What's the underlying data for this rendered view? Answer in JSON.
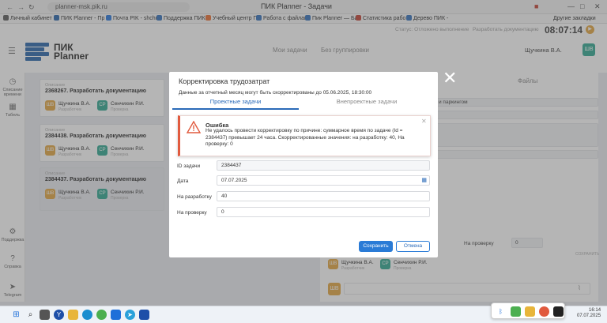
{
  "browser": {
    "url": "planner-msk.pik.ru",
    "window_title": "ПИК Planner - Задачи",
    "other_bookmarks": "Другие закладки",
    "bookmarks": [
      {
        "label": "Личный кабинет",
        "color": "#555555"
      },
      {
        "label": "ПИК Planner - Пр",
        "color": "#1f5fa8"
      },
      {
        "label": "Почта PIK - shchu",
        "color": "#1e6fd9"
      },
      {
        "label": "Поддержка ПИК",
        "color": "#2a6ab8"
      },
      {
        "label": "Учебный центр П",
        "color": "#e8692a"
      },
      {
        "label": "Работа с файлам",
        "color": "#2a6ab8"
      },
      {
        "label": "Пик Planner — Ба",
        "color": "#2a6ab8"
      },
      {
        "label": "Статистика рабо",
        "color": "#c0392b"
      },
      {
        "label": "Дерево ПИК -",
        "color": "#2a6ab8"
      }
    ]
  },
  "header": {
    "status_hint": "Статус: Отложено выполнение",
    "doc_hint": "Разработать документацию",
    "timer": "08:07:14",
    "logo_line1": "ПИК",
    "logo_line2": "Planner",
    "tab_my_tasks": "Мои задачи",
    "tab_no_group": "Без группировки",
    "user_name": "Щучкина В.А.",
    "user_initials": "ШВ"
  },
  "sidebar": {
    "items": [
      {
        "label": "Списание времени",
        "icon": "clock-icon"
      },
      {
        "label": "Табель",
        "icon": "table-icon"
      },
      {
        "label": "Поддержка",
        "icon": "support-icon"
      },
      {
        "label": "Справка",
        "icon": "help-icon"
      },
      {
        "label": "Telegram",
        "icon": "telegram-icon"
      }
    ]
  },
  "tasks": [
    {
      "label": "Описание",
      "title": "2368267. Разработать документацию",
      "p1_name": "Щучкина В.А.",
      "p1_role": "Разработчик",
      "p1_init": "ШВ",
      "p2_name": "Сенчихин Р.И.",
      "p2_role": "Проверка",
      "p2_init": "СР"
    },
    {
      "label": "Описание",
      "title": "2384438. Разработать документацию",
      "p1_name": "Щучкина В.А.",
      "p1_role": "Разработчик",
      "p1_init": "ШВ",
      "p2_name": "Сенчихин Р.И.",
      "p2_role": "Проверка",
      "p2_init": "СР"
    },
    {
      "label": "Описание",
      "title": "2384437. Разработать документацию",
      "p1_name": "Щучкина В.А.",
      "p1_role": "Разработчик",
      "p1_init": "ШВ",
      "p2_name": "Сенчихин Р.И.",
      "p2_role": "Проверка",
      "p2_init": "СР"
    }
  ],
  "right_panel": {
    "tab_files": "Файлы",
    "field1": "и паркингом",
    "check_label": "На проверку",
    "check_value": "0",
    "save_link": "СОХРАНИТЬ",
    "p1_name": "Щучкина В.А.",
    "p1_role": "Разработчик",
    "p1_init": "ШВ",
    "p2_name": "Сенчихин Р.И.",
    "p2_role": "Проверка",
    "p2_init": "СР",
    "comment_init": "ШВ"
  },
  "modal": {
    "title": "Корректировка трудозатрат",
    "subtitle": "Данные за отчетный месяц могут быть скорректированы до 05.06.2025, 18:30:00",
    "tab_project": "Проектные задачи",
    "tab_nonproject": "Внепроектные задачи",
    "fields": [
      {
        "label": "ID задачи",
        "value": "2384437"
      },
      {
        "label": "Дата",
        "value": "07.07.2025"
      },
      {
        "label": "На разработку",
        "value": "40"
      },
      {
        "label": "На проверку",
        "value": "0"
      }
    ],
    "save_button": "Сохранить",
    "cancel_button": "Отмена"
  },
  "alert": {
    "title": "Ошибка",
    "message": "Не удалось провести корректировку по причине: суммарное время по задаче (Id = 2384437) превышает 24 часа. Скорректированные значения: на разработку: 40, На проверку: 0"
  },
  "taskbar": {
    "time": "16:14",
    "date": "07.07.2025"
  },
  "colors": {
    "brand_blue": "#1f5fa8",
    "accent_button": "#2a7bd6",
    "error": "#e15a3e",
    "avatar_orange": "#e2a33a",
    "avatar_teal": "#27a58c"
  }
}
